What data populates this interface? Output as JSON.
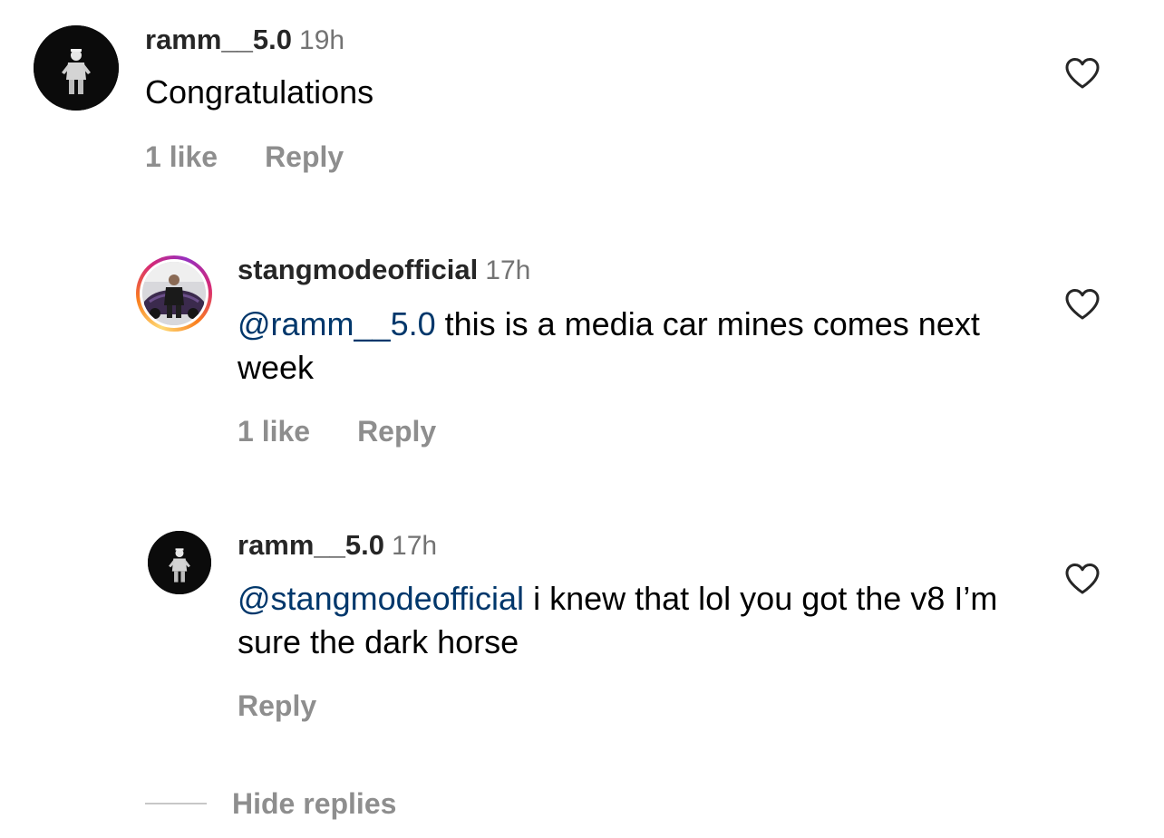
{
  "comments": [
    {
      "username": "ramm__5.0",
      "time": "19h",
      "mention": "",
      "text": "Congratulations",
      "likes": "1 like",
      "reply_label": "Reply",
      "avatar": "person-on-black-avatar"
    },
    {
      "username": "stangmodeofficial",
      "time": "17h",
      "mention": "@ramm__5.0",
      "text": " this is a media car mines comes next week",
      "likes": "1 like",
      "reply_label": "Reply",
      "avatar": "person-with-car-avatar",
      "has_story_ring": true
    },
    {
      "username": "ramm__5.0",
      "time": "17h",
      "mention": "@stangmodeofficial",
      "text": " i knew that lol you got the v8 I’m sure the dark horse",
      "likes": "",
      "reply_label": "Reply",
      "avatar": "person-on-black-avatar"
    }
  ],
  "hide_replies_label": "Hide replies",
  "colors": {
    "mention": "#00376b",
    "secondary_text": "#8e8e8e",
    "timestamp": "#737373"
  },
  "icons": {
    "like": "heart-outline-icon"
  }
}
